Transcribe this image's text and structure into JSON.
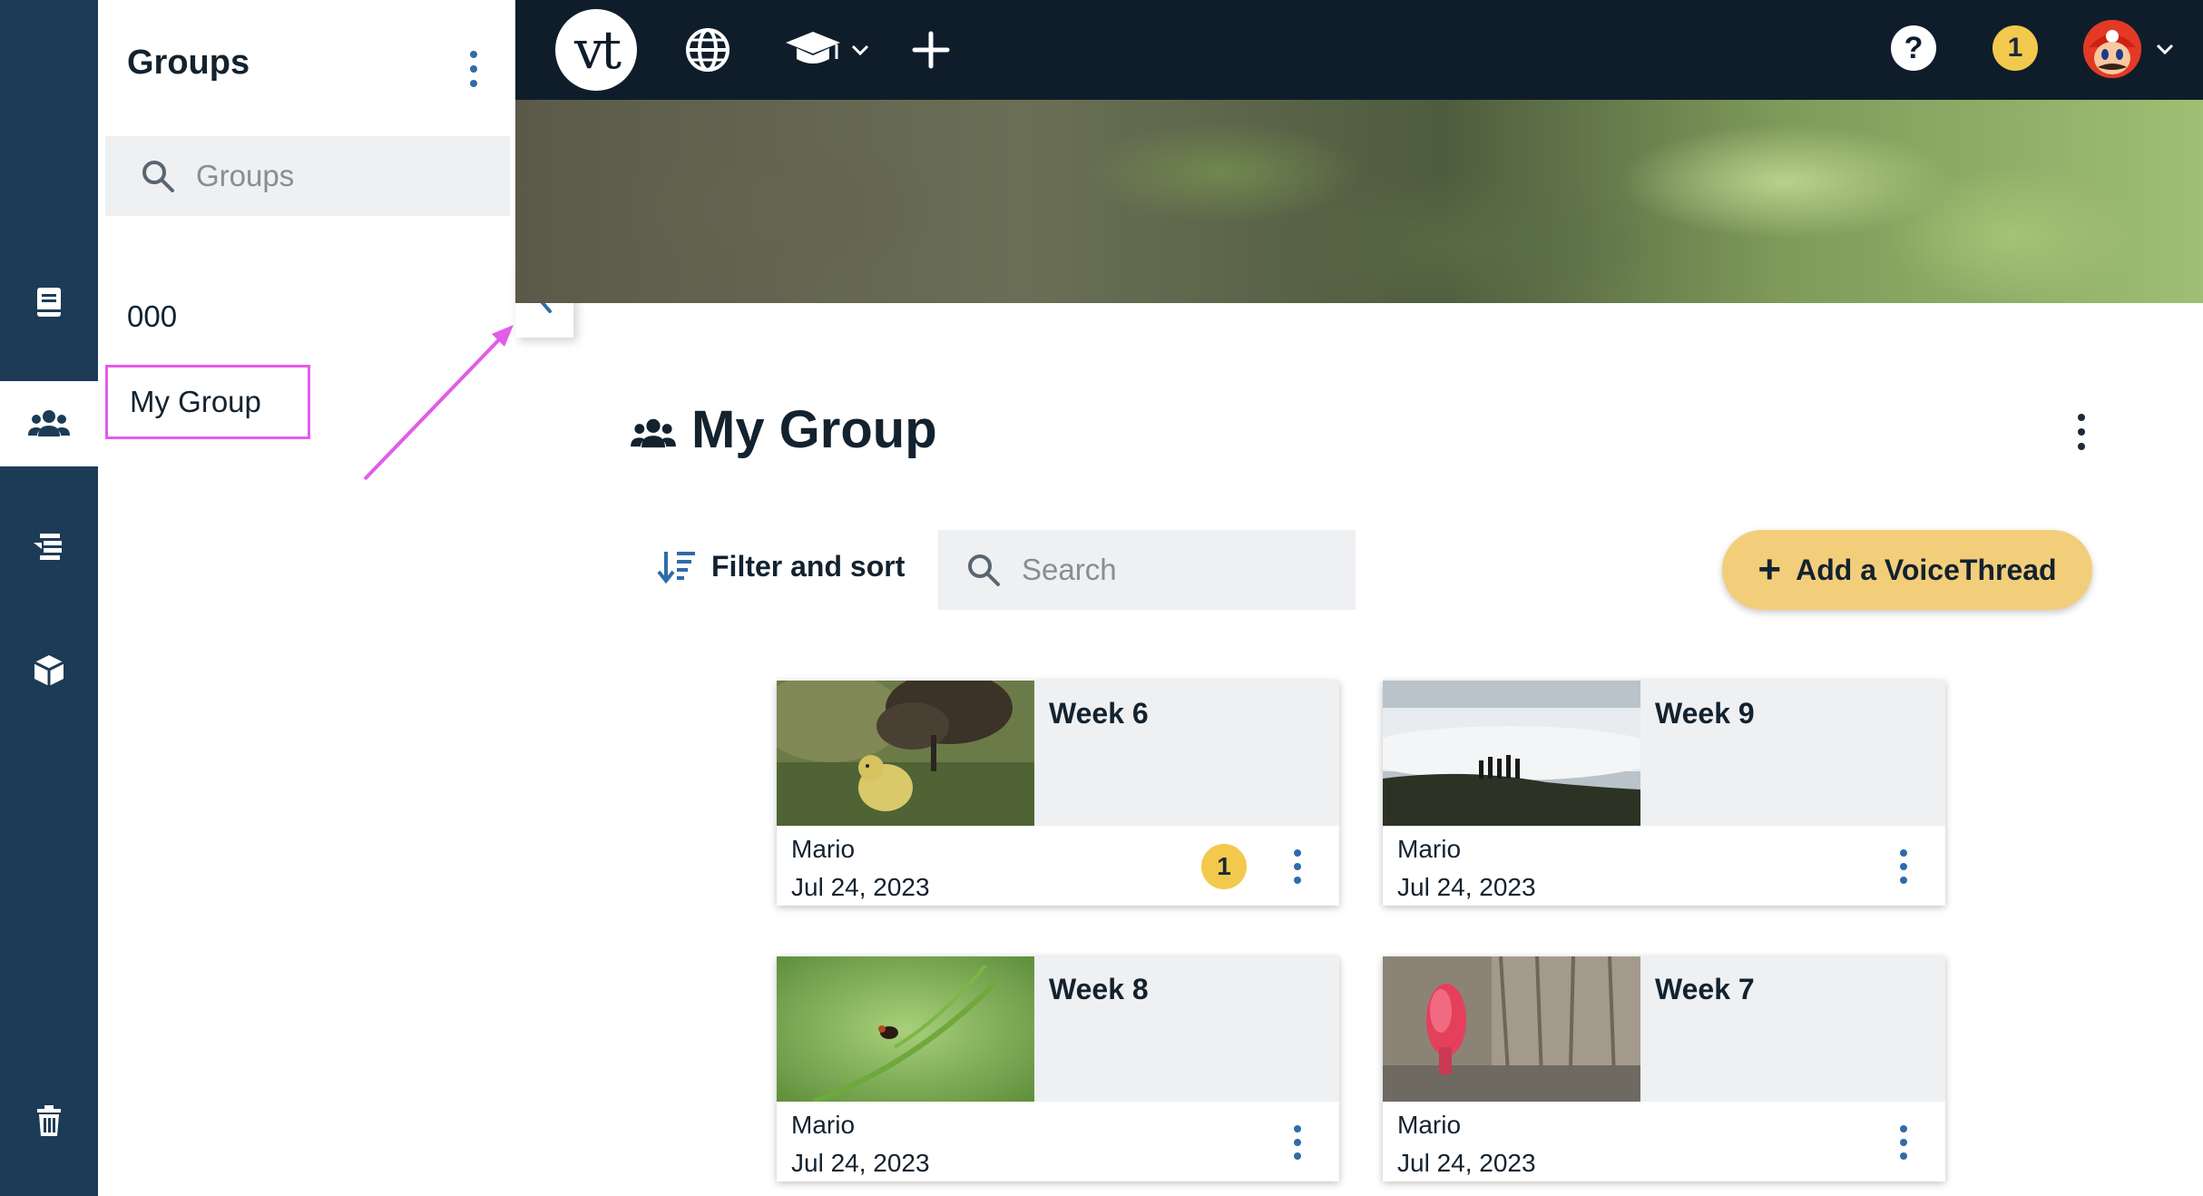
{
  "app": {
    "logo_text": "vt"
  },
  "colors": {
    "rail": "#1c3b57",
    "topnav": "#0f1d2b",
    "accent": "#f3ce7a",
    "badge": "#f2c94c",
    "highlight": "#e25ce8",
    "link": "#2f6ca8"
  },
  "rail": {
    "items": [
      {
        "icon": "book-icon"
      },
      {
        "icon": "group-icon",
        "active": true
      },
      {
        "icon": "list-tree-icon"
      },
      {
        "icon": "box-icon"
      },
      {
        "icon": "trash-icon"
      }
    ]
  },
  "groups_panel": {
    "title": "Groups",
    "search_placeholder": "Groups",
    "items": [
      {
        "label": "000"
      },
      {
        "label": "My Group",
        "selected": true
      }
    ]
  },
  "topnav": {
    "icons": [
      "globe-icon",
      "graduation-cap-icon",
      "plus-icon"
    ],
    "help_label": "?",
    "notification_count": "1"
  },
  "page": {
    "title": "My Group",
    "filter_sort_label": "Filter and sort",
    "search_placeholder": "Search",
    "add_button_label": "Add a VoiceThread"
  },
  "cards": [
    {
      "title": "Week 6",
      "author": "Mario",
      "date": "Jul 24, 2023",
      "badge": "1",
      "thumb": "gosling-photo"
    },
    {
      "title": "Week 9",
      "author": "Mario",
      "date": "Jul 24, 2023",
      "thumb": "hilltop-silhouettes-photo"
    },
    {
      "title": "Week 8",
      "author": "Mario",
      "date": "Jul 24, 2023",
      "thumb": "insect-on-stem-photo"
    },
    {
      "title": "Week 7",
      "author": "Mario",
      "date": "Jul 24, 2023",
      "thumb": "red-fungus-on-bark-photo"
    }
  ]
}
